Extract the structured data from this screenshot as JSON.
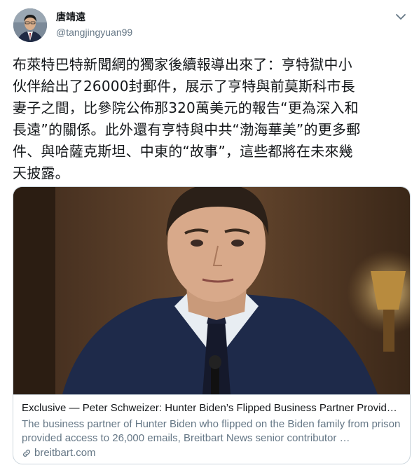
{
  "author": {
    "display_name": "唐靖遠",
    "handle": "@tangjingyuan99",
    "avatar_icon": "user-avatar-photo"
  },
  "tweet": {
    "text": "布萊特巴特新聞網的獨家後續報導出來了：亨特獄中小\n伙伴給出了26000封郵件，展示了亨特與前莫斯科市長\n妻子之間，比參院公佈那320萬美元的報告“更為深入和\n長遠”的關係。此外還有亨特與中共“渤海華美”的更多郵\n件、與哈薩克斯坦、中東的“故事”，這些都將在未來幾\n天披露。"
  },
  "card": {
    "title": "Exclusive — Peter Schweizer: Hunter Biden’s Flipped Business Partner Provid…",
    "description": "The business partner of Hunter Biden who flipped on the Biden family from prison provided access to 26,000 emails, Breitbart News senior contributor …",
    "domain": "breitbart.com",
    "image_icon": "news-photo-man-in-suit"
  },
  "colors": {
    "text_primary": "#14171a",
    "text_secondary": "#657786",
    "border": "#ccd6dd"
  }
}
